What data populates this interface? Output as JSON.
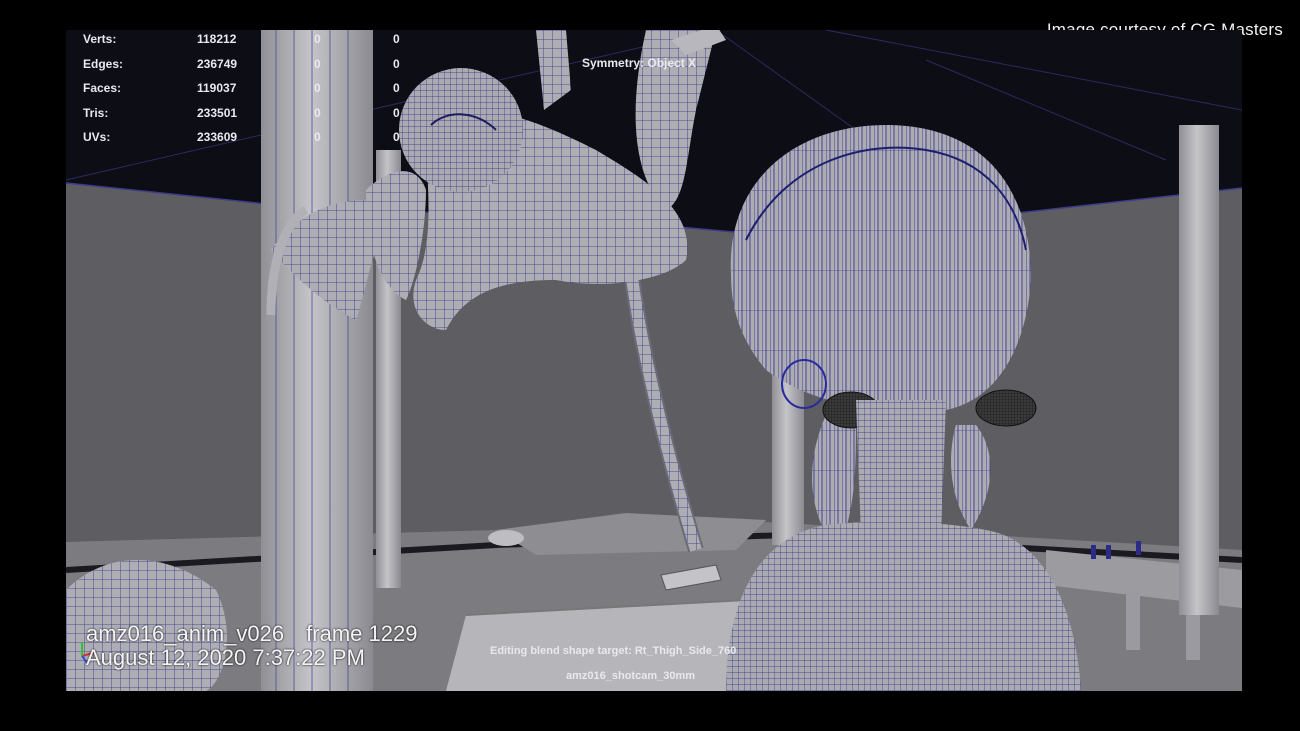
{
  "credit": "Image courtesy of CG Masters",
  "hud": {
    "stats": [
      {
        "label": "Verts:",
        "value": "118212",
        "a": "0",
        "b": "0"
      },
      {
        "label": "Edges:",
        "value": "236749",
        "a": "0",
        "b": "0"
      },
      {
        "label": "Faces:",
        "value": "119037",
        "a": "0",
        "b": "0"
      },
      {
        "label": "Tris:",
        "value": "233501",
        "a": "0",
        "b": "0"
      },
      {
        "label": "UVs:",
        "value": "233609",
        "a": "0",
        "b": "0"
      }
    ],
    "symmetry": "Symmetry: Object X",
    "shot_name": "amz016_anim_v026",
    "frame": "frame 1229",
    "datetime": "August 12, 2020 7:37:22 PM",
    "blend_shape": "Editing blend shape target: Rt_Thigh_Side_760",
    "camera": "amz016_shotcam_30mm"
  },
  "colors": {
    "wireframe": "#2b2b8c",
    "surface": "#a9a9ae",
    "background": "#000000"
  }
}
